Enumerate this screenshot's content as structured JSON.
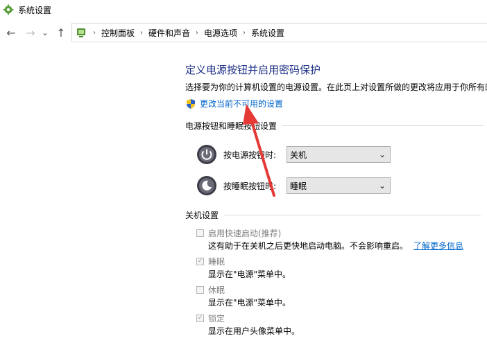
{
  "window": {
    "title": "系统设置"
  },
  "nav": {
    "back_glyph": "←",
    "forward_glyph": "→",
    "recent_glyph": "⌄",
    "up_glyph": "↑"
  },
  "breadcrumb": [
    "控制面板",
    "硬件和声音",
    "电源选项",
    "系统设置"
  ],
  "breadcrumb_sep": "›",
  "page": {
    "heading": "定义电源按钮并启用密码保护",
    "description": "选择要为你的计算机设置的电源设置。在此页上对设置所做的更改将应用于你所有的",
    "change_link": "更改当前不可用的设置"
  },
  "power_buttons": {
    "group_title": "电源按钮和睡眠按钮设置",
    "rows": [
      {
        "label": "按电源按钮时:",
        "value": "关机"
      },
      {
        "label": "按睡眠按钮时:",
        "value": "睡眠"
      }
    ]
  },
  "shutdown": {
    "group_title": "关机设置",
    "options": [
      {
        "name": "启用快速启动(推荐)",
        "checked": false,
        "description": "这有助于在关机之后更快地启动电脑。不会影响重启。",
        "link": "了解更多信息"
      },
      {
        "name": "睡眠",
        "checked": true,
        "description": "显示在\"电源\"菜单中。"
      },
      {
        "name": "休眠",
        "checked": false,
        "description": "显示在\"电源\"菜单中。"
      },
      {
        "name": "锁定",
        "checked": true,
        "description": "显示在用户头像菜单中。"
      }
    ]
  },
  "glyphs": {
    "check": "✓",
    "dropdown": "⌄"
  },
  "colors": {
    "heading": "#1e3287",
    "link": "#0066cc",
    "annotation_arrow": "#e53935"
  }
}
